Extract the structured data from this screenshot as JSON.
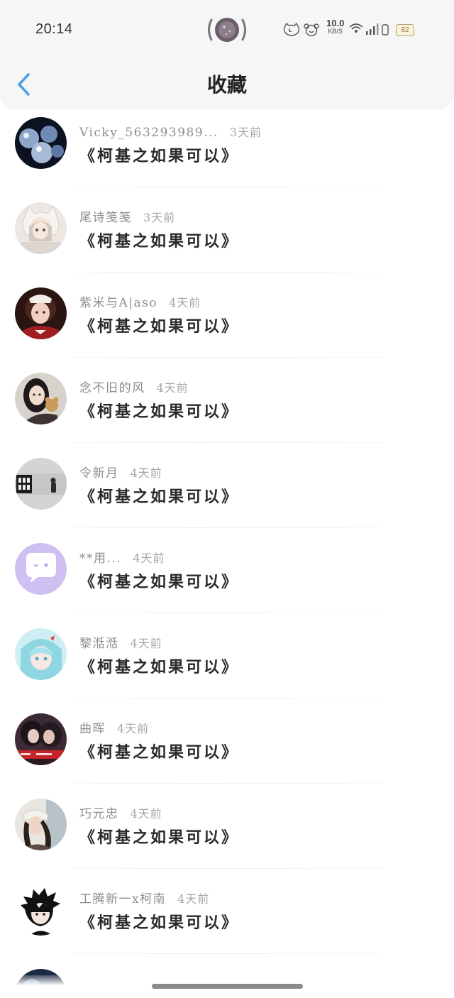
{
  "status_bar": {
    "time": "20:14",
    "net_speed": "10.0",
    "net_unit": "KB/S",
    "battery": "82"
  },
  "header": {
    "title": "收藏"
  },
  "favorites": [
    {
      "user": "Vicky_563293989...",
      "time": "3天前",
      "title": "《柯基之如果可以》"
    },
    {
      "user": "尾诗笺笺",
      "time": "3天前",
      "title": "《柯基之如果可以》"
    },
    {
      "user": "紫米与A|aso",
      "time": "4天前",
      "title": "《柯基之如果可以》"
    },
    {
      "user": "念不旧的风",
      "time": "4天前",
      "title": "《柯基之如果可以》"
    },
    {
      "user": "令新月",
      "time": "4天前",
      "title": "《柯基之如果可以》"
    },
    {
      "user": "**用...",
      "time": "4天前",
      "title": "《柯基之如果可以》"
    },
    {
      "user": "黎湉湉",
      "time": "4天前",
      "title": "《柯基之如果可以》"
    },
    {
      "user": "曲晖",
      "time": "4天前",
      "title": "《柯基之如果可以》"
    },
    {
      "user": "巧元忠",
      "time": "4天前",
      "title": "《柯基之如果可以》"
    },
    {
      "user": "工腾新一x柯南",
      "time": "4天前",
      "title": "《柯基之如果可以》"
    },
    {
      "user": "",
      "time": "",
      "title": ""
    }
  ],
  "colors": {
    "header_bg": "#f6f6f7",
    "back_arrow": "#4a9fe8",
    "title_text": "#222222",
    "meta_text": "#8d8d8d"
  },
  "icons": {
    "back": "chevron-left-icon",
    "status": [
      "cat-icon",
      "bear-icon",
      "wifi-icon",
      "signal-icon",
      "vibrate-icon",
      "battery-icon"
    ]
  }
}
